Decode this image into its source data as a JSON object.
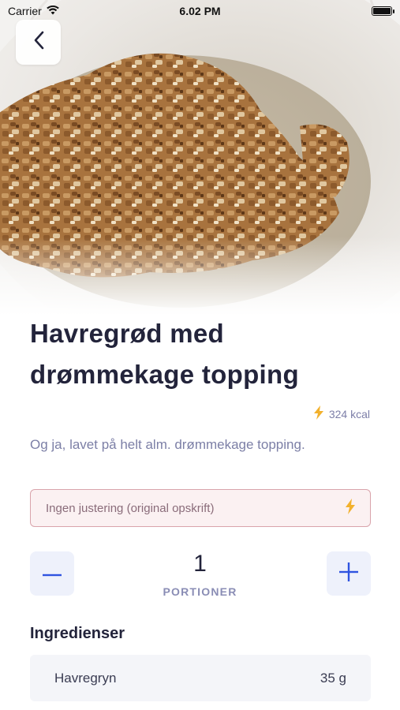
{
  "status_bar": {
    "carrier": "Carrier",
    "time": "6.02 PM"
  },
  "recipe": {
    "title": "Havregrød med drømmekage topping",
    "kcal": "324 kcal",
    "description": "Og ja, lavet på helt alm. drømmekage topping.",
    "hero_image_icon": "oatmeal-photo"
  },
  "adjustment": {
    "label": "Ingen justering (original opskrift)",
    "icon": "lightning-icon"
  },
  "portions": {
    "value": "1",
    "label": "PORTIONER"
  },
  "ingredients": {
    "title": "Ingredienser",
    "items": [
      {
        "name": "Havregryn",
        "amount": "35 g"
      }
    ]
  },
  "colors": {
    "accent": "#2f54e0",
    "lightning": "#f2b12d",
    "adjust_border": "#d9a4ab",
    "adjust_bg": "#fbf1f2",
    "muted_text": "#7c7fa6"
  }
}
